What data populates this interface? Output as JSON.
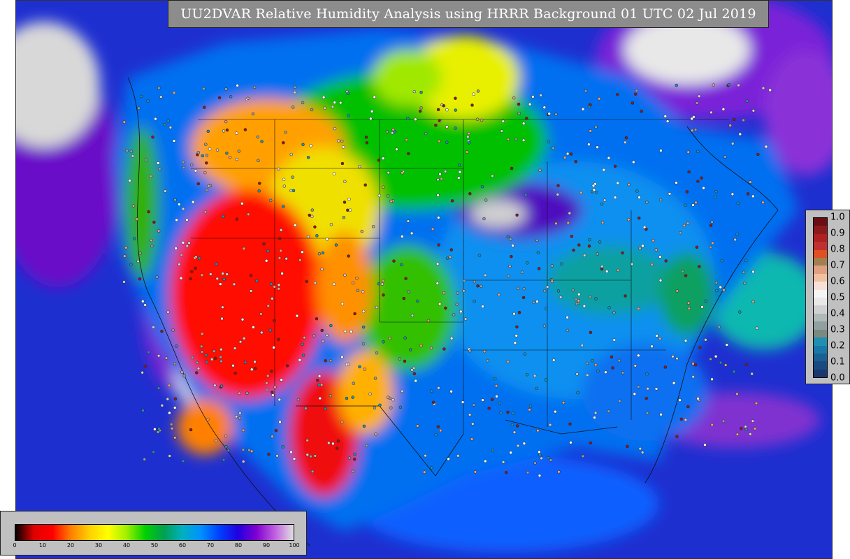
{
  "title": "UU2DVAR Relative Humidity Analysis using HRRR Background 01 UTC 02 Jul 2019",
  "rh_colorbar": {
    "ticks": [
      "0",
      "10",
      "20",
      "30",
      "40",
      "50",
      "60",
      "70",
      "80",
      "90",
      "100"
    ],
    "gradient": [
      "#000000",
      "#e00000",
      "#ff0000",
      "#ff8000",
      "#ffd000",
      "#ffff00",
      "#a0f000",
      "#00d000",
      "#00a050",
      "#00b0c0",
      "#0090ff",
      "#0040ff",
      "#2000e0",
      "#8000d0",
      "#c060e0",
      "#e0e0e0"
    ]
  },
  "innovation_legend": {
    "ticks": [
      "1.0",
      "0.9",
      "0.8",
      "0.7",
      "0.6",
      "0.5",
      "0.4",
      "0.3",
      "0.2",
      "0.1",
      "0.0"
    ],
    "colors": [
      "#6a0d14",
      "#8c1a1a",
      "#b02020",
      "#c03030",
      "#e05020",
      "#a08050",
      "#e0a080",
      "#f0c0a0",
      "#f8e0d8",
      "#f5f5f5",
      "#e8e8e8",
      "#d0d0d0",
      "#b0b8b8",
      "#90a0a0",
      "#7a8a80",
      "#2090b0",
      "#1878a8",
      "#1a6090",
      "#1a4a80",
      "#1a3870"
    ]
  },
  "map": {
    "colors": {
      "very_dry": "#ff0000",
      "dry": "#ff8000",
      "moderate": "#ffff00",
      "humid": "#00c800",
      "very_humid": "#0060ff",
      "saturated": "#7000d0",
      "cloud": "#d0d0d0",
      "ocean": "#1e2fd0"
    }
  }
}
